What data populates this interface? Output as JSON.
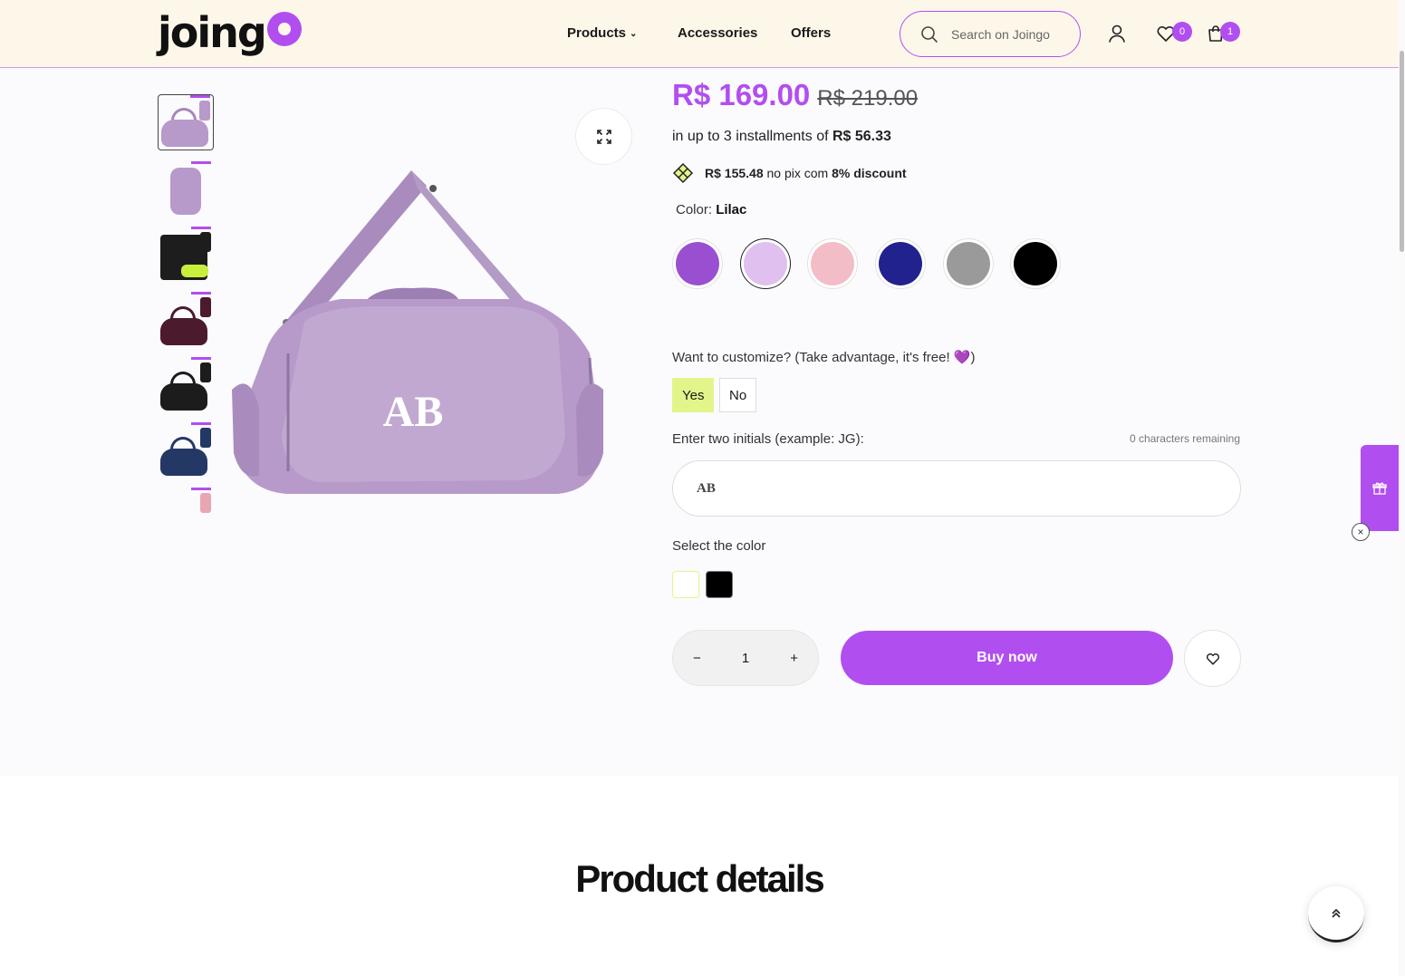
{
  "header": {
    "logo_text": "joing",
    "nav": [
      {
        "label": "Products",
        "has_dropdown": true
      },
      {
        "label": "Accessories"
      },
      {
        "label": "Offers"
      }
    ],
    "search_placeholder": "Search on Joingo",
    "wishlist_count": "0",
    "cart_count": "1"
  },
  "gallery": {
    "thumbnails": [
      {
        "color": "#b79ac9",
        "kind": "duffel",
        "active": true
      },
      {
        "color": "#b79ac9",
        "kind": "backpack"
      },
      {
        "color": "#1d1d1d",
        "kind": "open"
      },
      {
        "color": "#4b1a2d",
        "kind": "duffel"
      },
      {
        "color": "#1c1c1c",
        "kind": "duffel"
      },
      {
        "color": "#243865",
        "kind": "duffel"
      },
      {
        "color": "#e8a6b2",
        "kind": "duffel"
      }
    ],
    "monogram": "AB"
  },
  "product": {
    "price_now": "R$ 169.00",
    "price_old": "R$ 219.00",
    "installments_text": "in up to 3 installments of ",
    "installments_value": "R$ 56.33",
    "pix_value": "R$ 155.48",
    "pix_text": " no pix com ",
    "pix_discount": "8% discount",
    "color_label": "Color: ",
    "color_selected": "Lilac",
    "swatches": [
      {
        "name": "Purple",
        "hex": "#9a4fd0"
      },
      {
        "name": "Lilac",
        "hex": "#dfc0ee",
        "selected": true
      },
      {
        "name": "Pink",
        "hex": "#f3bdc8"
      },
      {
        "name": "Navy",
        "hex": "#22228f"
      },
      {
        "name": "Grey",
        "hex": "#9a9a9a"
      },
      {
        "name": "Black",
        "hex": "#000000"
      }
    ],
    "customize_question": "Want to customize? (Take advantage, it's free! 💜)",
    "yes_label": "Yes",
    "no_label": "No",
    "initials_label": "Enter two initials (example: JG):",
    "initials_remaining": "0 characters remaining",
    "initials_value": "AB",
    "select_color_label": "Select the color",
    "monogram_colors": [
      "#ffffff",
      "#000000"
    ],
    "quantity": "1",
    "minus": "−",
    "plus": "+",
    "buy_label": "Buy now"
  },
  "details": {
    "heading": "Product details"
  },
  "colors": {
    "accent": "#b14ef0",
    "header_bg": "#fdf7ea",
    "yes_bg": "#e2f58a"
  }
}
